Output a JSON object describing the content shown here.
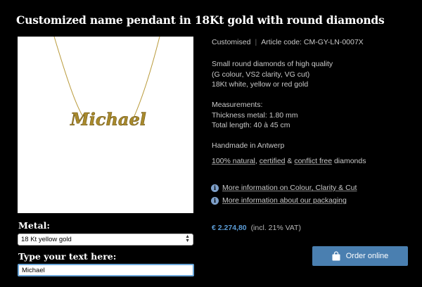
{
  "title": "Customized name pendant in 18Kt gold with round diamonds",
  "pendant_name": "Michael",
  "meta": {
    "category": "Customised",
    "article_code": "Article code: CM-GY-LN-0007X"
  },
  "description": [
    "Small round diamonds of high quality",
    "(G colour, VS2 clarity, VG cut)",
    "18Kt white, yellow or red gold"
  ],
  "measurements": [
    "Measurements:",
    "Thickness metal: 1.80 mm",
    "Total length: 40 à 45 cm"
  ],
  "handmade": "Handmade in Antwerp",
  "natural": {
    "part1": "100% natural",
    "sep1": ", ",
    "part2": "certified",
    "sep2": " & ",
    "part3": "conflict free",
    "part4": " diamonds"
  },
  "links": {
    "colour": "More information on Colour, Clarity & Cut",
    "packaging": "More information about our packaging"
  },
  "form": {
    "metal_label": "Metal:",
    "metal_value": "18 Kt yellow gold",
    "text_label": "Type your text here:",
    "text_value": "Michael"
  },
  "price": {
    "amount": "€ 2.274,80",
    "vat": "(incl. 21% VAT)"
  },
  "order_button": "Order online",
  "colors": {
    "background": "#000000",
    "accent": "#4a7fb0",
    "price": "#5b9bd5",
    "gold": "#b99a3a"
  }
}
